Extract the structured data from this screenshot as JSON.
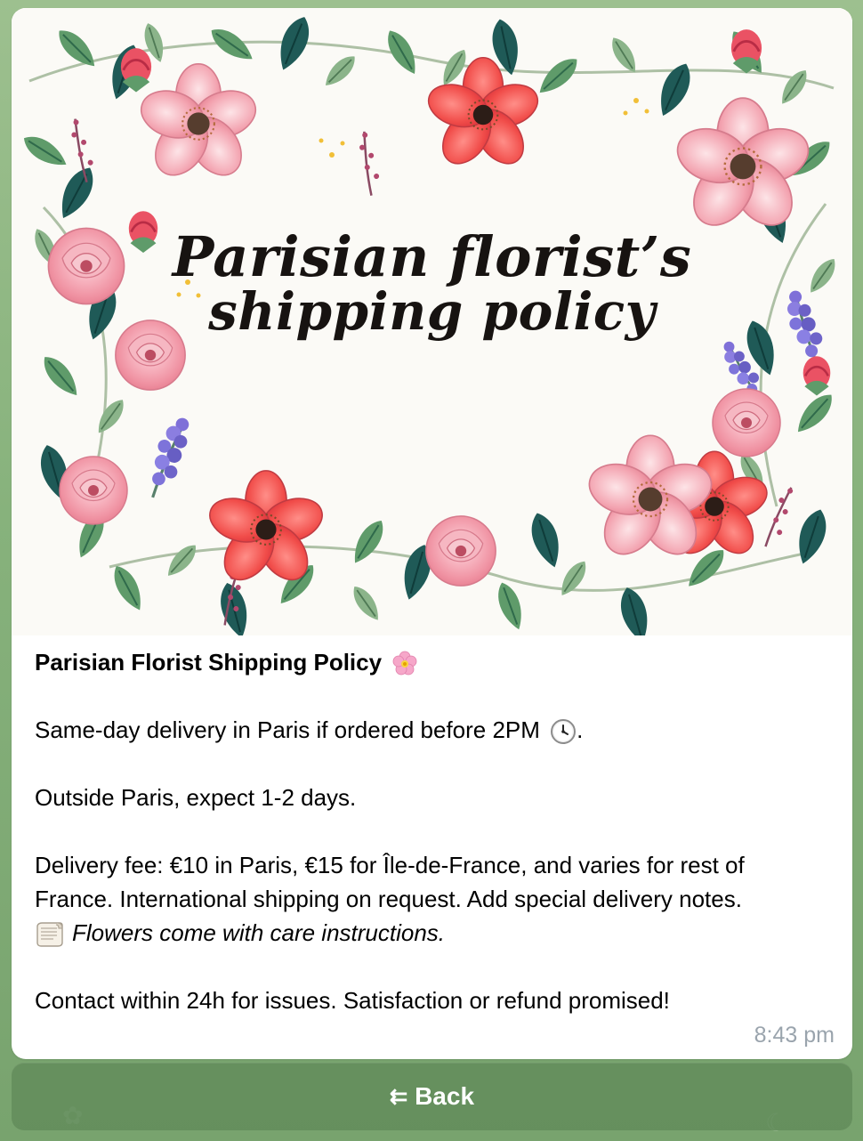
{
  "message": {
    "hero_title": {
      "line1": "Parisian florist’s",
      "line2": "shipping policy"
    },
    "text": {
      "title": "Parisian Florist Shipping Policy",
      "line1": "Same-day delivery in Paris if ordered before 2PM",
      "line1_end": ".",
      "line2": "Outside Paris, expect 1-2 days.",
      "line3a": "Delivery fee: €10 in Paris, €15 for Île-de-France, and varies for rest of",
      "line3b": "France. International shipping on request. Add special delivery notes.",
      "line3c": "Flowers come with care instructions.",
      "line4": "Contact within 24h for issues. Satisfaction or refund promised!"
    },
    "timestamp": "8:43 pm",
    "icons": {
      "title": "cherry-blossom-icon",
      "time": "clock-icon",
      "notes": "scroll-icon"
    }
  },
  "button": {
    "icon": "⇇",
    "label": "Back"
  },
  "colors": {
    "background": "#87b27c",
    "message": "#ffffff",
    "button": "#5e8858",
    "text": "#000000",
    "timestamp": "#9aa4ad"
  }
}
